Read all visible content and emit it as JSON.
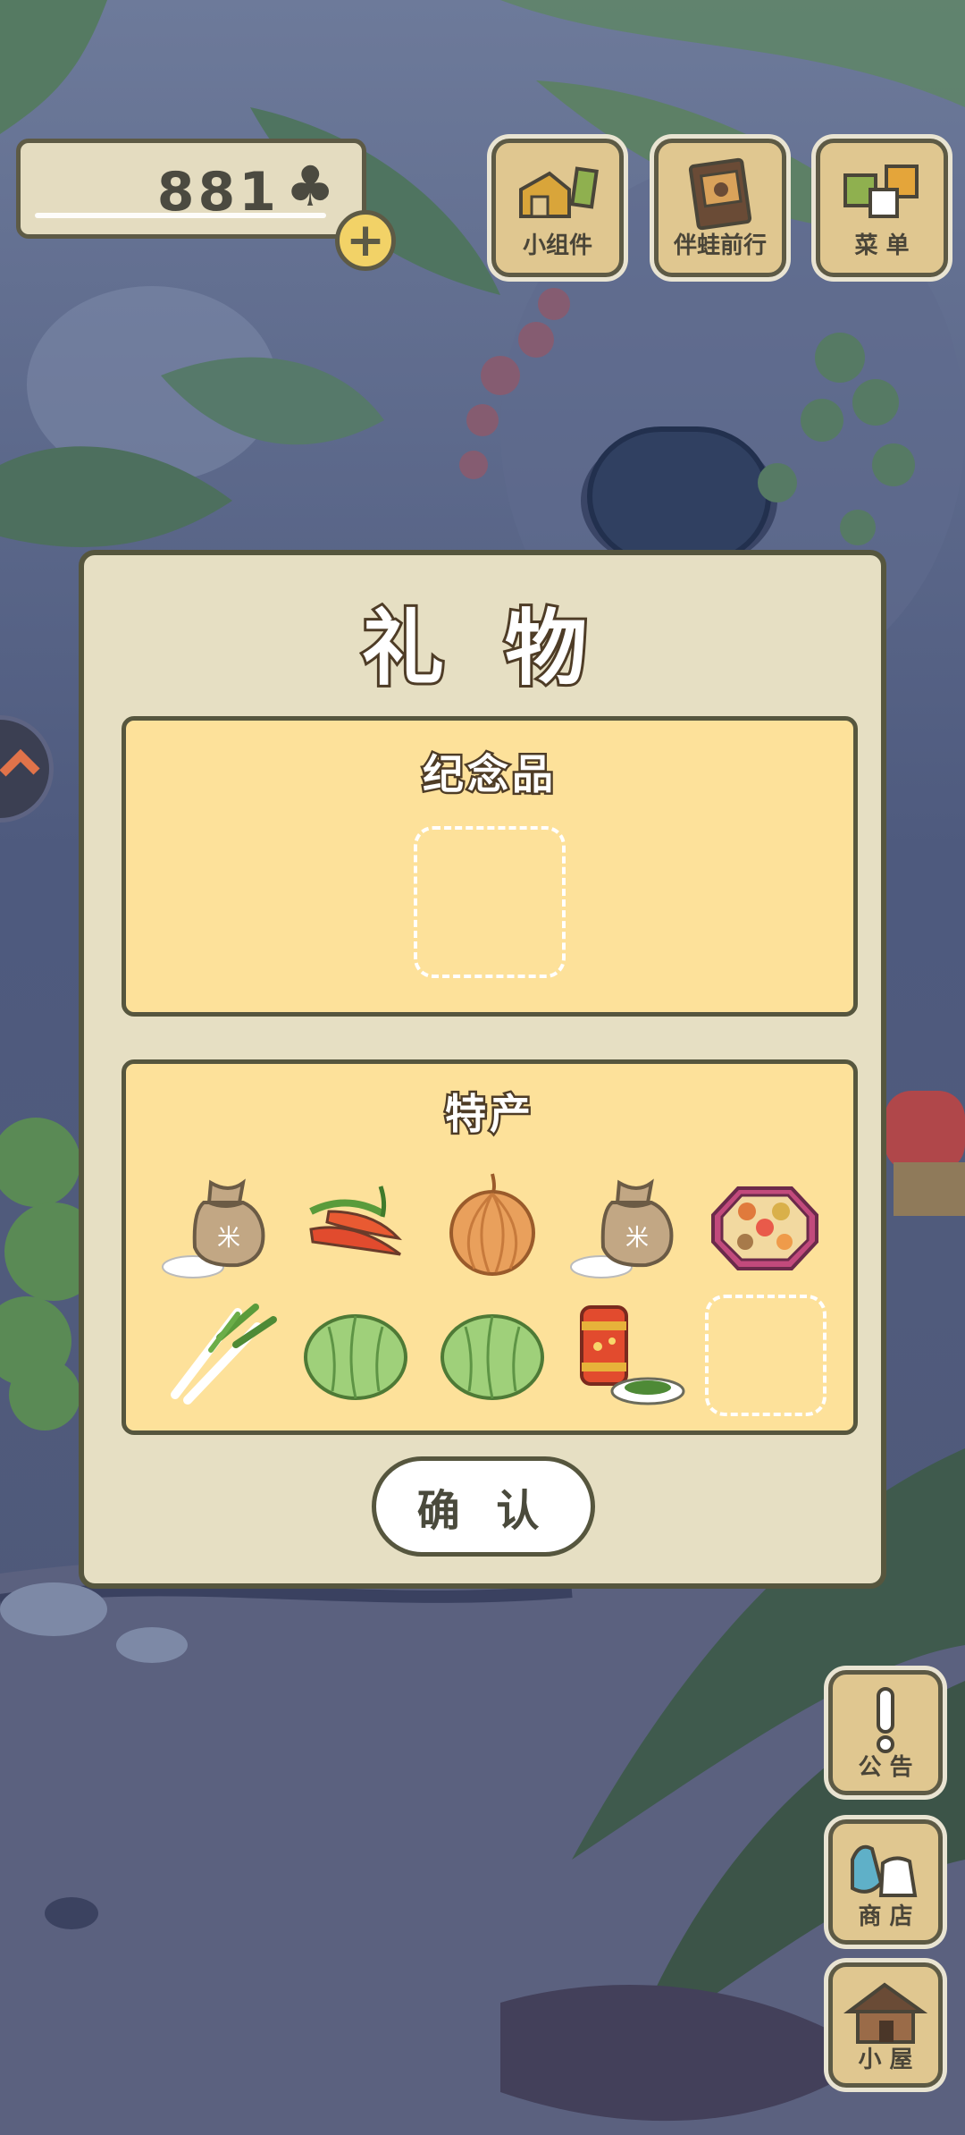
{
  "currency": {
    "amount": "881",
    "icon": "clover-icon"
  },
  "top_buttons": [
    {
      "label": "小组件",
      "icon": "widget-icon"
    },
    {
      "label": "伴蛙前行",
      "icon": "album-icon"
    },
    {
      "label": "菜 单",
      "icon": "menu-icon"
    }
  ],
  "side_buttons": [
    {
      "label": "公 告",
      "icon": "exclamation-icon"
    },
    {
      "label": "商 店",
      "icon": "shop-bag-icon"
    },
    {
      "label": "小 屋",
      "icon": "house-icon"
    }
  ],
  "modal": {
    "title": "礼 物",
    "souvenir_title": "纪念品",
    "specialty_title": "特产",
    "specialty_items": [
      {
        "icon": "rice-sack-icon"
      },
      {
        "icon": "chili-pepper-icon"
      },
      {
        "icon": "onion-icon"
      },
      {
        "icon": "rice-sack-icon"
      },
      {
        "icon": "bento-box-icon"
      },
      {
        "icon": "green-onion-icon"
      },
      {
        "icon": "cabbage-icon"
      },
      {
        "icon": "cabbage-icon"
      },
      {
        "icon": "tea-can-icon"
      },
      {
        "icon": "empty-slot"
      }
    ],
    "confirm_label": "确 认"
  },
  "colors": {
    "panel": "#e6dfc3",
    "section": "#fde19a",
    "border": "#56563e",
    "button": "#e0c790"
  }
}
